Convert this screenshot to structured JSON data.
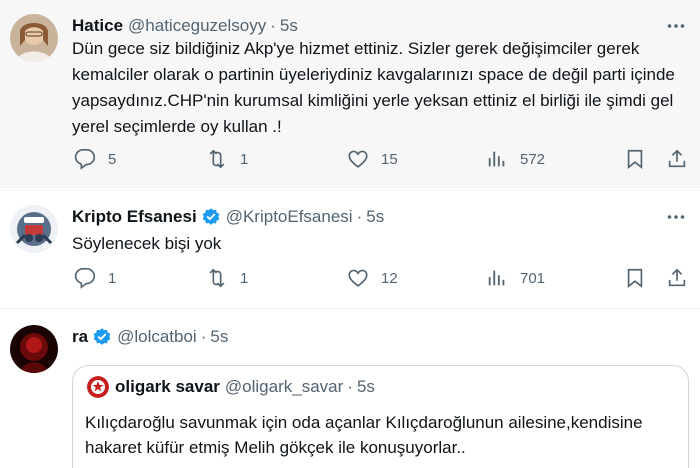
{
  "tweets": [
    {
      "name": "Hatice",
      "handle": "@haticeguzelsoyy",
      "dot": "·",
      "time": "5s",
      "text": "Dün gece siz bildiğiniz Akp'ye hizmet ettiniz. Sizler gerek değişimciler gerek kemalciler olarak o partinin üyeleriydiniz kavgalarınızı space de değil parti içinde  yapsaydınız.CHP'nin kurumsal kimliğini yerle yeksan ettiniz el birliği ile şimdi gel yerel seçimlerde oy kullan .!",
      "replies": "5",
      "retweets": "1",
      "likes": "15",
      "views": "572"
    },
    {
      "name": "Kripto Efsanesi",
      "handle": "@KriptoEfsanesi",
      "dot": "·",
      "time": "5s",
      "text": "Söylenecek bişi yok",
      "replies": "1",
      "retweets": "1",
      "likes": "12",
      "views": "701"
    },
    {
      "name": "ra",
      "handle": "@lolcatboi",
      "dot": "·",
      "time": "5s",
      "quote": {
        "name": "oligark savar",
        "handle": "@oligark_savar",
        "dot": "·",
        "time": "5s",
        "text": "Kılıçdaroğlu savunmak için oda açanlar Kılıçdaroğlunun ailesine,kendisine hakaret küfür etmiş Melih gökçek ile konuşuyorlar.."
      }
    }
  ],
  "colors": {
    "text": "#0f1419",
    "secondary": "#536471",
    "verified": "#1d9bf0",
    "border": "#cfd9de"
  },
  "icons": [
    "more-icon",
    "reply-icon",
    "retweet-icon",
    "like-icon",
    "views-icon",
    "bookmark-icon",
    "share-icon",
    "verified-icon"
  ]
}
